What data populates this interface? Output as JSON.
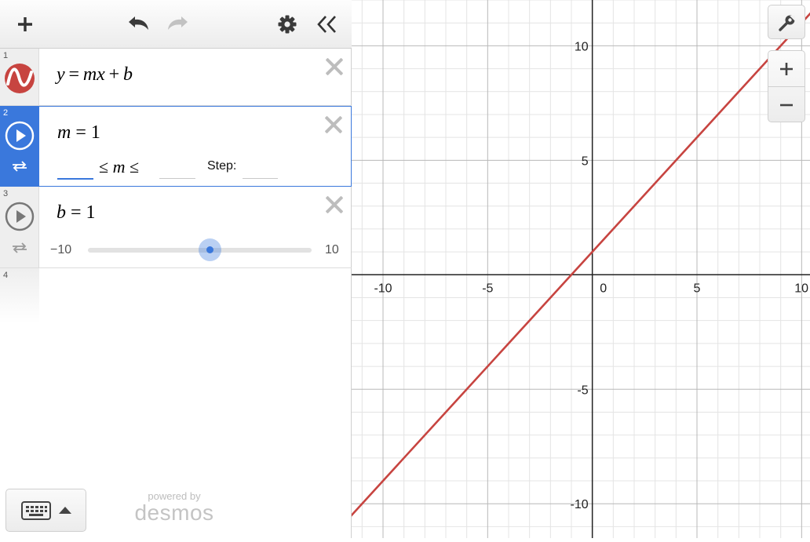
{
  "toolbar": {
    "add_icon": "plus-icon",
    "undo_icon": "undo-icon",
    "redo_icon": "redo-icon",
    "settings_icon": "gear-icon",
    "collapse_icon": "double-chevron-left-icon"
  },
  "expressions": [
    {
      "index": "1",
      "latex": "y = mx + b",
      "color": "#c74440",
      "icon": "wave-icon"
    },
    {
      "index": "2",
      "variable": "m",
      "value": "1",
      "slider_min": "",
      "slider_max": "",
      "step_label": "Step:",
      "step": "",
      "icon": "play-icon",
      "loop_icon": "loop-icon",
      "selected": true
    },
    {
      "index": "3",
      "variable": "b",
      "value": "1",
      "slider_min": "−10",
      "slider_max": "10",
      "slider_value": 1,
      "icon": "play-icon",
      "loop_icon": "loop-icon"
    },
    {
      "index": "4",
      "latex": ""
    }
  ],
  "keyboard": {
    "icon": "keyboard-icon",
    "toggle_icon": "caret-up-icon"
  },
  "branding": {
    "powered_by": "powered by",
    "name": "desmos"
  },
  "graph": {
    "x_range": [
      -11.5,
      10.4
    ],
    "y_range": [
      -11.5,
      12.0
    ],
    "x_tick_labels": [
      "-10",
      "-5",
      "0",
      "5",
      "10"
    ],
    "y_tick_labels": [
      "10",
      "5",
      "-5",
      "-10"
    ],
    "controls": {
      "settings_icon": "wrench-icon",
      "zoom_in_icon": "plus-icon",
      "zoom_out_icon": "minus-icon"
    }
  },
  "chart_data": {
    "type": "line",
    "series": [
      {
        "name": "y = mx + b",
        "x": [
          -12,
          12
        ],
        "y": [
          -11,
          13
        ],
        "color": "#c74440"
      }
    ],
    "x_ticks": [
      -10,
      -5,
      0,
      5,
      10
    ],
    "y_ticks": [
      -10,
      -5,
      5,
      10
    ],
    "xlim": [
      -11.5,
      10.4
    ],
    "ylim": [
      -11.5,
      12.0
    ],
    "grid": true
  }
}
